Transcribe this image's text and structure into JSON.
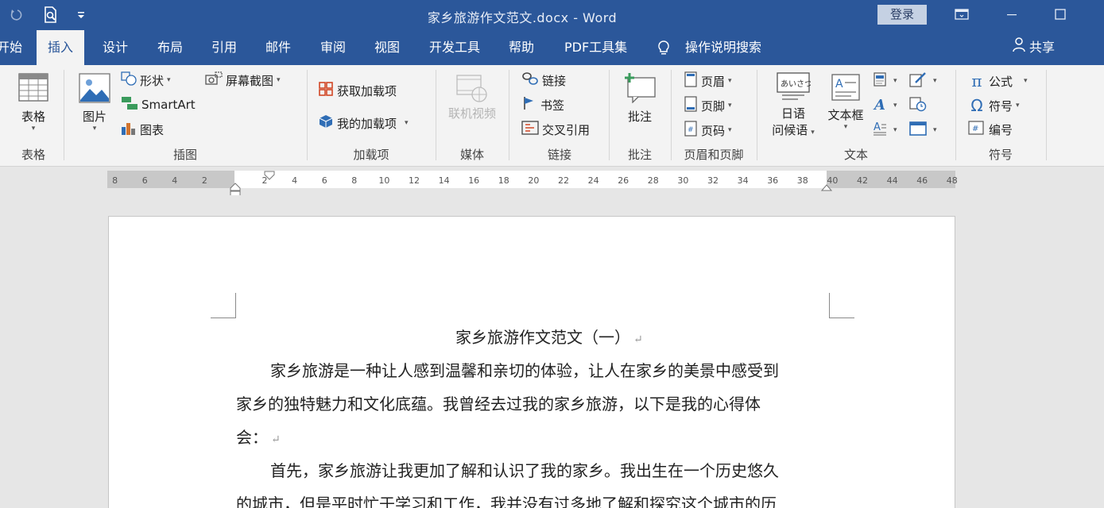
{
  "title_bar": {
    "title": "家乡旅游作文范文.docx  -  Word",
    "login": "登录",
    "undo_icon": "undo-icon",
    "print_preview_icon": "print-preview-icon",
    "customize_icon": "customize-quick-access-icon"
  },
  "tabs": {
    "start": "开始",
    "insert": "插入",
    "design": "设计",
    "layout": "布局",
    "references": "引用",
    "mailings": "邮件",
    "review": "审阅",
    "view": "视图",
    "developer": "开发工具",
    "help": "帮助",
    "pdf": "PDF工具集",
    "tell_me": "操作说明搜索",
    "share": "共享"
  },
  "ribbon": {
    "table": {
      "button": "表格",
      "group": "表格"
    },
    "illustrations": {
      "picture": "图片",
      "shapes": "形状",
      "smartart": "SmartArt",
      "chart": "图表",
      "screenshot": "屏幕截图",
      "group": "插图"
    },
    "addins": {
      "get": "获取加载项",
      "my": "我的加载项",
      "group": "加载项"
    },
    "media": {
      "online_video": "联机视频",
      "group": "媒体"
    },
    "links": {
      "link": "链接",
      "bookmark": "书签",
      "cross_ref": "交叉引用",
      "group": "链接"
    },
    "comments": {
      "comment": "批注",
      "group": "批注"
    },
    "header_footer": {
      "header": "页眉",
      "footer": "页脚",
      "page_number": "页码",
      "group": "页眉和页脚"
    },
    "text": {
      "japanese_1": "日语",
      "japanese_2": "问候语",
      "textbox": "文本框",
      "group": "文本"
    },
    "symbols": {
      "equation": "公式",
      "symbol": "符号",
      "number": "编号",
      "group": "符号"
    }
  },
  "ruler": {
    "left_ticks": [
      "8",
      "6",
      "4",
      "2"
    ],
    "right_ticks": [
      "2",
      "4",
      "6",
      "8",
      "10",
      "12",
      "14",
      "16",
      "18",
      "20",
      "22",
      "24",
      "26",
      "28",
      "30",
      "32",
      "34",
      "36",
      "38",
      "40",
      "42",
      "44",
      "46",
      "48"
    ]
  },
  "document": {
    "heading": "家乡旅游作文范文（一）",
    "lines": [
      "家乡旅游是一种让人感到温馨和亲切的体验，让人在家乡的美景中感受到",
      "家乡的独特魅力和文化底蕴。我曾经去过我的家乡旅游，以下是我的心得体",
      "会：",
      "首先，家乡旅游让我更加了解和认识了我的家乡。我出生在一个历史悠久",
      "的城市，但是平时忙于学习和工作，我并没有过多地了解和探究这个城市的历"
    ],
    "paragraph_mark": "↵"
  }
}
